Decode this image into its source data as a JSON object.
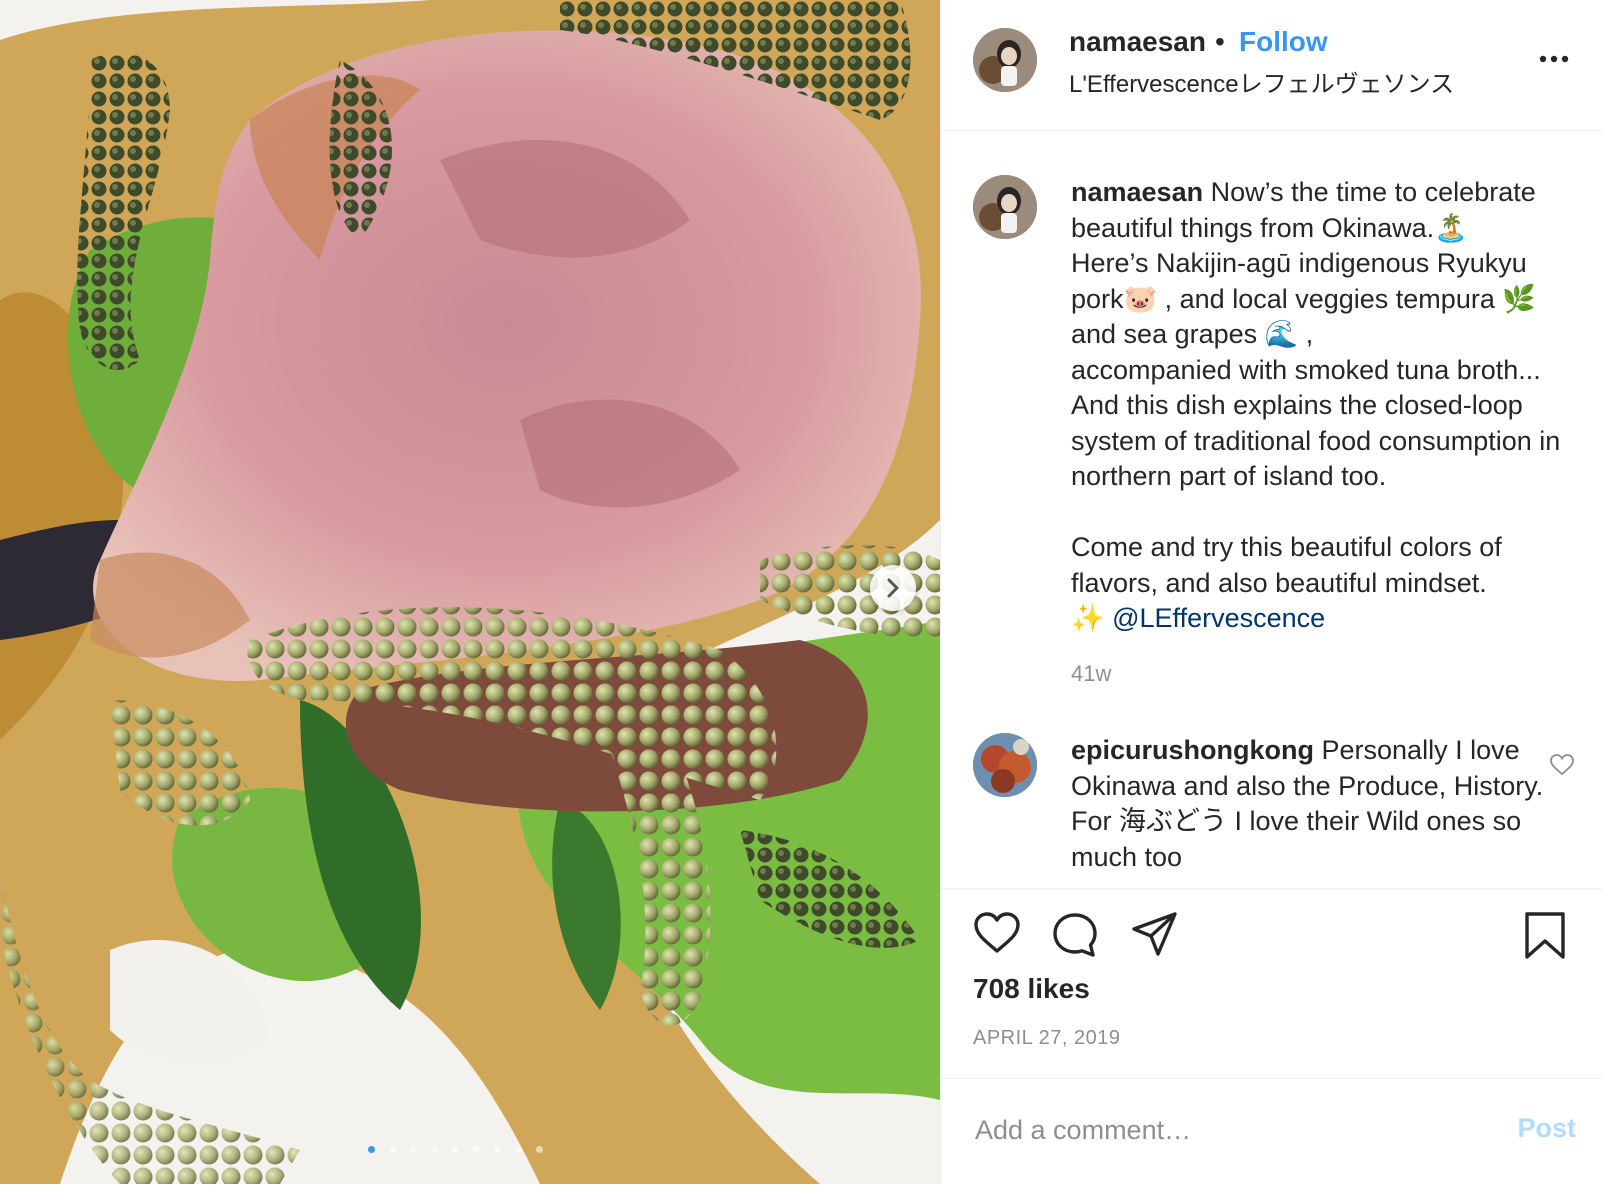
{
  "post": {
    "username": "namaesan",
    "separator": "•",
    "follow_label": "Follow",
    "location": "L'Effervescenceレフェルヴェソンス",
    "more_label": "..."
  },
  "caption": {
    "username": "namaesan",
    "text": " Now’s the time to celebrate beautiful things from Okinawa.🏝️\nHere’s Nakijin-agū indigenous Ryukyu pork🐷 , and local veggies tempura 🌿\nand sea grapes 🌊 ,\naccompanied with smoked tuna broth...\nAnd this dish explains the closed-loop system of traditional food consumption in northern part of island too.\n\nCome and try this beautiful colors of flavors, and also beautiful mindset.\n✨ ",
    "mention": "@LEffervescence",
    "time": "41w"
  },
  "comments": [
    {
      "username": "epicurushongkong",
      "text": " Personally I love Okinawa and also the Produce, History. For 海ぶどう I love their Wild ones so much too"
    }
  ],
  "stats": {
    "likes": "708 likes",
    "date": "APRIL 27, 2019"
  },
  "add_comment": {
    "placeholder": "Add a comment…",
    "post_label": "Post"
  },
  "carousel": {
    "total_slides": 9,
    "current_slide": 1
  },
  "colors": {
    "link": "#3897f0",
    "mention": "#003569",
    "muted": "#8e8e8e",
    "post_disabled": "#b3dbff"
  },
  "icons": [
    "heart-icon",
    "comment-icon",
    "share-icon",
    "bookmark-icon",
    "chevron-right-icon",
    "more-icon"
  ]
}
